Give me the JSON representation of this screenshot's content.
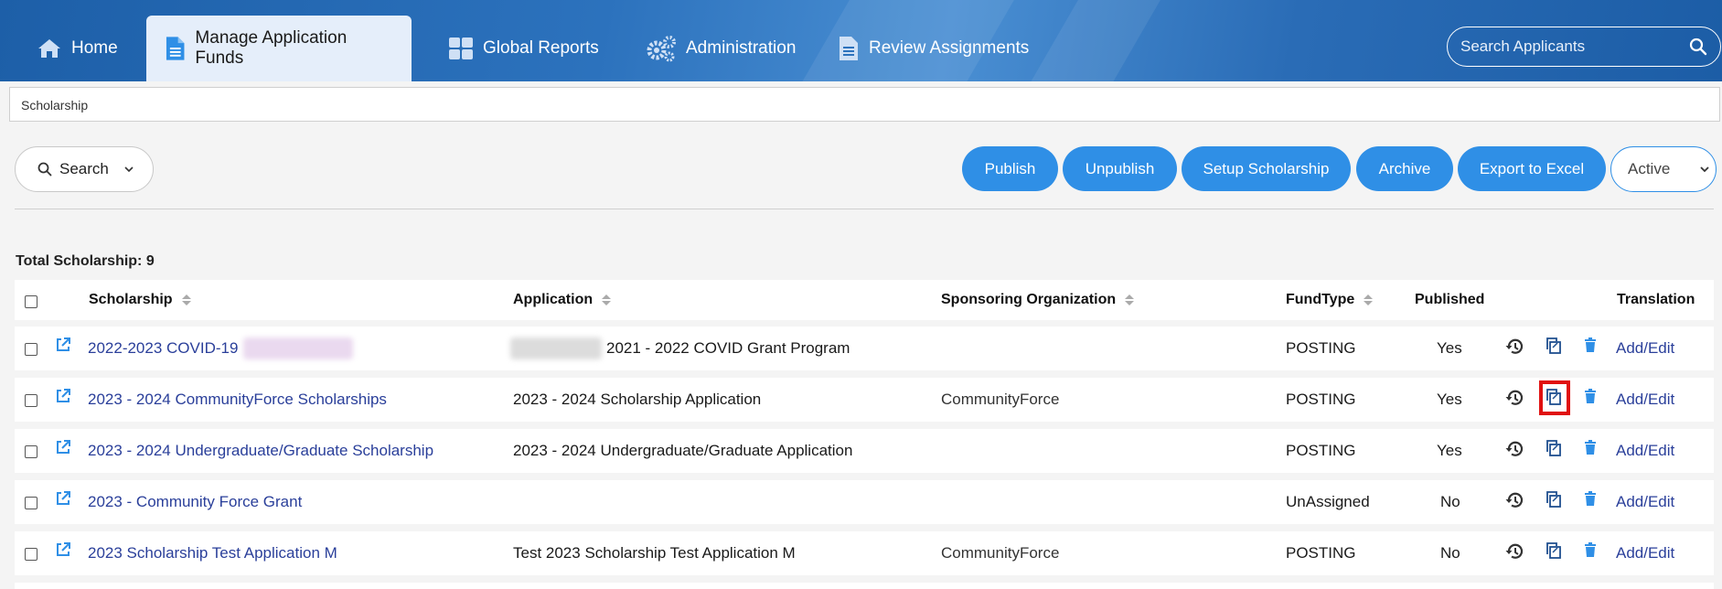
{
  "nav": {
    "home": "Home",
    "manage": "Manage Application Funds",
    "reports": "Global Reports",
    "admin": "Administration",
    "review": "Review Assignments",
    "search_placeholder": "Search Applicants"
  },
  "breadcrumb": "Scholarship",
  "toolbar": {
    "search_label": "Search",
    "publish": "Publish",
    "unpublish": "Unpublish",
    "setup": "Setup Scholarship",
    "archive": "Archive",
    "export": "Export to Excel",
    "status": "Active"
  },
  "total": {
    "label": "Total Scholarship:",
    "count": "9"
  },
  "columns": {
    "scholarship": "Scholarship",
    "application": "Application",
    "sponsor": "Sponsoring Organization",
    "fundtype": "FundType",
    "published": "Published",
    "translation": "Translation"
  },
  "rows": [
    {
      "scholarship": "2022-2023 COVID-19",
      "application": "2021 - 2022 COVID Grant Program",
      "sponsor": "",
      "fundtype": "POSTING",
      "published": "Yes",
      "translation": "Add/Edit"
    },
    {
      "scholarship": "2023 - 2024 CommunityForce Scholarships",
      "application": "2023 - 2024 Scholarship Application",
      "sponsor": "CommunityForce",
      "fundtype": "POSTING",
      "published": "Yes",
      "translation": "Add/Edit"
    },
    {
      "scholarship": "2023 - 2024 Undergraduate/Graduate Scholarship",
      "application": "2023 - 2024 Undergraduate/Graduate Application",
      "sponsor": "",
      "fundtype": "POSTING",
      "published": "Yes",
      "translation": "Add/Edit"
    },
    {
      "scholarship": "2023 - Community Force Grant",
      "application": "",
      "sponsor": "",
      "fundtype": "UnAssigned",
      "published": "No",
      "translation": "Add/Edit"
    },
    {
      "scholarship": "2023 Scholarship Test Application M",
      "application": "Test 2023 Scholarship Test Application M",
      "sponsor": "CommunityForce",
      "fundtype": "POSTING",
      "published": "No",
      "translation": "Add/Edit"
    }
  ],
  "colors": {
    "nav": "#2c72bd",
    "accent": "#2f8fe6",
    "link": "#2a3f9a",
    "highlight": "#e01010"
  }
}
